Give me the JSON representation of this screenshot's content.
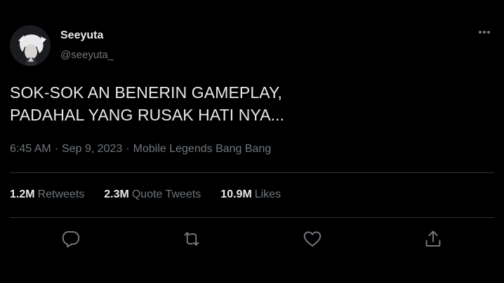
{
  "user": {
    "display_name": "Seeyuta",
    "handle": "@seeyuta_"
  },
  "tweet": {
    "text_lines": [
      "SOK-SOK AN BENERIN GAMEPLAY,",
      "PADAHAL YANG RUSAK HATI NYA..."
    ],
    "time": "6:45 AM",
    "date": "Sep 9, 2023",
    "source": "Mobile Legends Bang Bang",
    "separator": "·"
  },
  "stats": [
    {
      "value": "1.2M",
      "label": "Retweets"
    },
    {
      "value": "2.3M",
      "label": "Quote Tweets"
    },
    {
      "value": "10.9M",
      "label": "Likes"
    }
  ],
  "actions": {
    "reply_icon": "reply-icon",
    "retweet_icon": "retweet-icon",
    "like_icon": "heart-icon",
    "share_icon": "share-icon"
  },
  "colors": {
    "background": "#000000",
    "text_primary": "#e7e9ea",
    "text_secondary": "#71767b",
    "divider": "#2f3336"
  }
}
